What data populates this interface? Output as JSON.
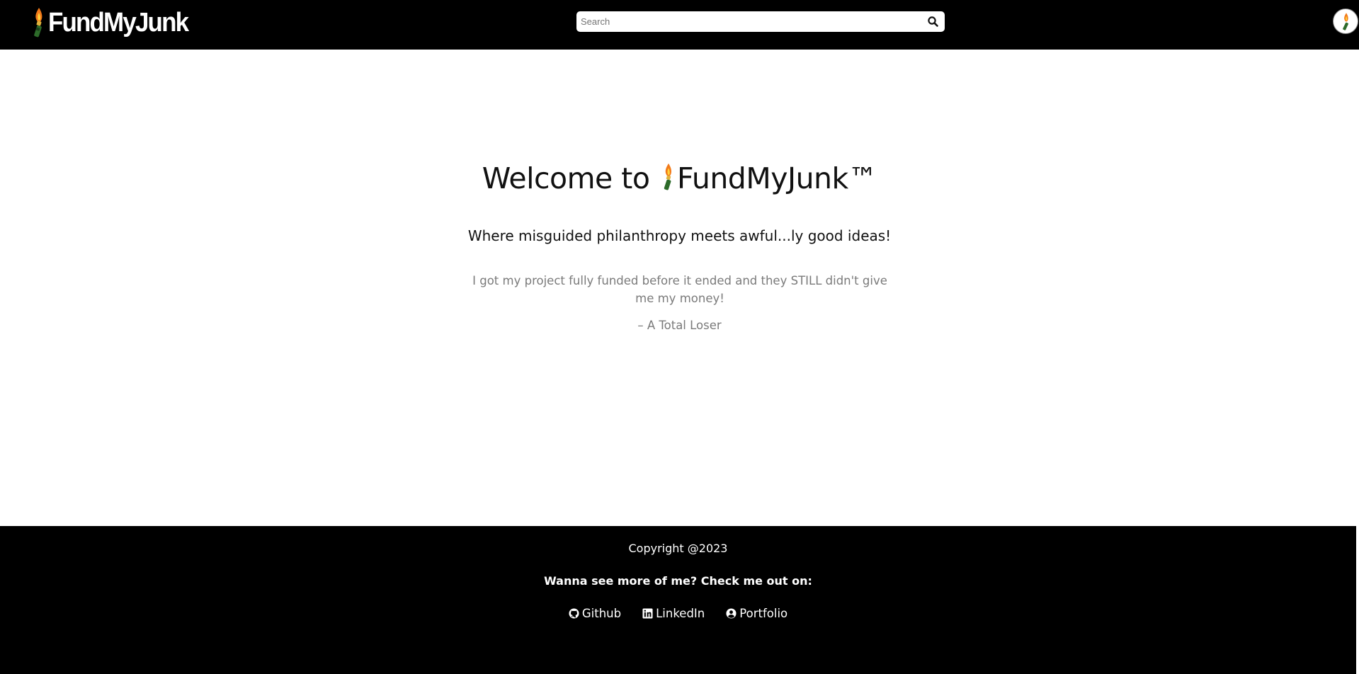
{
  "header": {
    "logo_text": "FundMyJunk",
    "search": {
      "placeholder": "Search",
      "value": ""
    }
  },
  "main": {
    "welcome_prefix": "Welcome to ",
    "welcome_brand": "FundMyJunk™",
    "tagline": "Where misguided philanthropy meets awful...ly good ideas!",
    "quote": "I got my project fully funded before it ended and they STILL didn't give me my money!",
    "quote_author": "– A Total Loser"
  },
  "footer": {
    "copyright": "Copyright @2023",
    "more": "Wanna see more of me? Check me out on:",
    "links": [
      {
        "label": "Github",
        "icon": "github-icon"
      },
      {
        "label": "LinkedIn",
        "icon": "linkedin-icon"
      },
      {
        "label": "Portfolio",
        "icon": "user-circle-icon"
      }
    ]
  },
  "colors": {
    "header_bg": "#000000",
    "footer_bg": "#000000",
    "quote_text": "#7a7a7a",
    "flame_orange": "#f27a1a",
    "flame_yellow": "#ffd23a",
    "torch_green": "#2d6b2a"
  }
}
